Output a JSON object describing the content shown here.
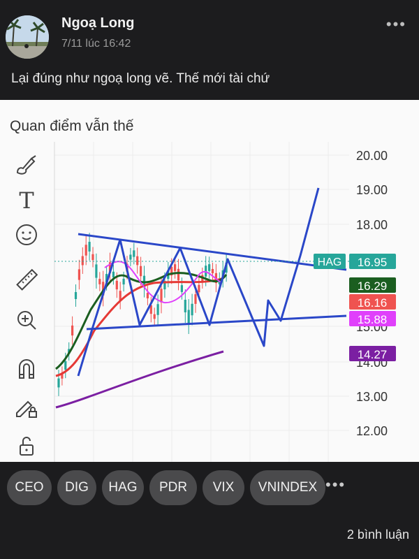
{
  "post": {
    "author": "Ngoạ Long",
    "time": "7/11 lúc 16:42",
    "text": "Lại đúng như ngoạ long vẽ. Thế mới tài chứ"
  },
  "image": {
    "caption": "Quan điểm vẫn thế"
  },
  "toolbar": {
    "icons": [
      "brush-icon",
      "text-icon",
      "emoji-icon",
      "ruler-icon",
      "zoom-in-icon",
      "magnet-icon",
      "pencil-lock-icon",
      "unlock-icon"
    ],
    "text_tool_label": "T"
  },
  "chart_data": {
    "type": "line",
    "ylim": [
      11.6,
      20.4
    ],
    "ticks": [
      {
        "v": 20.0,
        "t": "20.00"
      },
      {
        "v": 19.0,
        "t": "19.00"
      },
      {
        "v": 18.0,
        "t": "18.00"
      },
      {
        "v": 15.0,
        "t": "15.00"
      },
      {
        "v": 14.0,
        "t": "14.00"
      },
      {
        "v": 13.0,
        "t": "13.00"
      },
      {
        "v": 12.0,
        "t": "12.00"
      }
    ],
    "price_labels": [
      {
        "symbol": "HAG",
        "value": "16.95",
        "color": "#26a69a"
      },
      {
        "value": "16.29",
        "color": "#1b5e20"
      },
      {
        "value": "16.16",
        "color": "#ef5350"
      },
      {
        "value": "15.88",
        "color": "#e040fb"
      },
      {
        "value": "14.27",
        "color": "#7b1fa2"
      }
    ],
    "colors": {
      "projection": "#2a47c8",
      "ma_green": "#1b5e20",
      "ma_red": "#e53935",
      "ma_pink": "#e040fb",
      "ma_purple": "#7b1fa2",
      "up": "#26a69a",
      "down": "#ef5350"
    }
  },
  "tags": [
    "CEO",
    "DIG",
    "HAG",
    "PDR",
    "VIX",
    "VNINDEX"
  ],
  "comments_label": "2 bình luận"
}
